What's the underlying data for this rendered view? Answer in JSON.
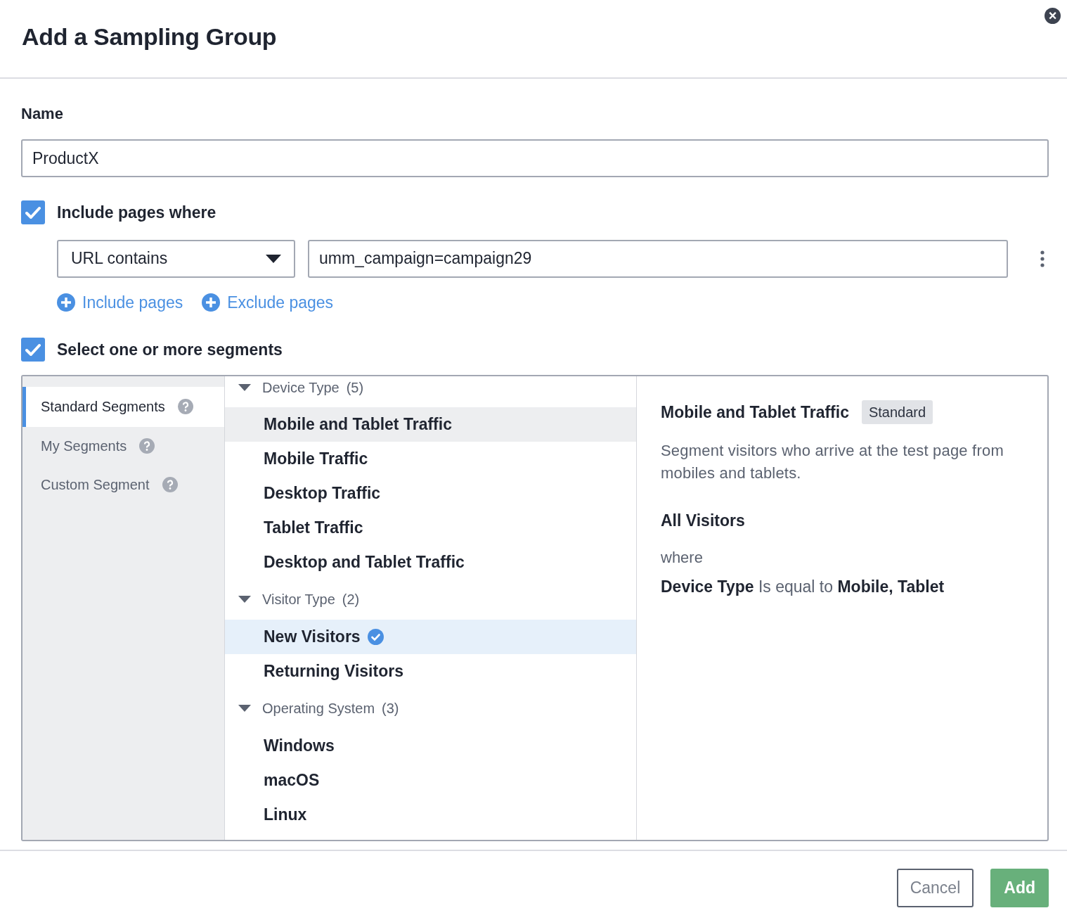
{
  "dialog": {
    "title": "Add a Sampling Group",
    "close_label": "×"
  },
  "name_field": {
    "label": "Name",
    "value": "ProductX"
  },
  "include_pages": {
    "checked": true,
    "label": "Include pages where",
    "rule": {
      "operator": "URL contains",
      "value": "umm_campaign=campaign29"
    },
    "links": [
      "Include pages",
      "Exclude pages"
    ]
  },
  "segments": {
    "checked": true,
    "label": "Select one or more segments",
    "tabs": [
      {
        "label": "Standard Segments",
        "selected": true
      },
      {
        "label": "My Segments",
        "selected": false
      },
      {
        "label": "Custom Segment",
        "selected": false
      }
    ],
    "groups": [
      {
        "label": "Device Type",
        "count": "(5)",
        "expanded": true,
        "items": [
          {
            "label": "Mobile and Tablet Traffic",
            "highlighted": true,
            "selected": false
          },
          {
            "label": "Mobile Traffic",
            "highlighted": false,
            "selected": false
          },
          {
            "label": "Desktop Traffic",
            "highlighted": false,
            "selected": false
          },
          {
            "label": "Tablet Traffic",
            "highlighted": false,
            "selected": false
          },
          {
            "label": "Desktop and Tablet Traffic",
            "highlighted": false,
            "selected": false
          }
        ]
      },
      {
        "label": "Visitor Type",
        "count": "(2)",
        "expanded": true,
        "items": [
          {
            "label": "New Visitors",
            "highlighted": false,
            "selected": true
          },
          {
            "label": "Returning Visitors",
            "highlighted": false,
            "selected": false
          }
        ]
      },
      {
        "label": "Operating System",
        "count": "(3)",
        "expanded": true,
        "items": [
          {
            "label": "Windows",
            "highlighted": false,
            "selected": false
          },
          {
            "label": "macOS",
            "highlighted": false,
            "selected": false
          },
          {
            "label": "Linux",
            "highlighted": false,
            "selected": false
          }
        ]
      }
    ],
    "detail": {
      "name": "Mobile and Tablet Traffic",
      "badge": "Standard",
      "description": "Segment visitors who arrive at the test page from mobiles and tablets.",
      "audience": "All Visitors",
      "where": "where",
      "condition": "**Device Type** Is equal to **Mobile, Tablet**"
    }
  },
  "buttons": [
    {
      "label": "Cancel",
      "kind": "secondary"
    },
    {
      "label": "Add",
      "kind": "primary"
    }
  ]
}
